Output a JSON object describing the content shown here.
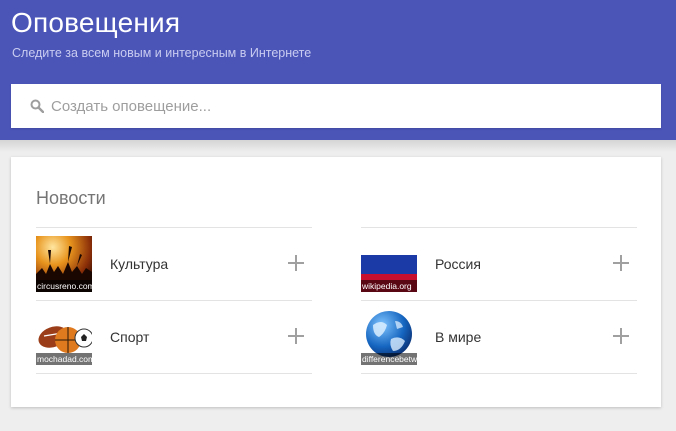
{
  "header": {
    "title": "Оповещения",
    "subtitle": "Следите за всем новым и интересным в Интернете",
    "color": "#4b55b8"
  },
  "search": {
    "placeholder": "Создать оповещение...",
    "icon": "search-icon"
  },
  "news": {
    "title": "Новости",
    "topics": [
      {
        "label": "Культура",
        "source": "circusreno.com",
        "icon": "plus-icon"
      },
      {
        "label": "Россия",
        "source": "wikipedia.org",
        "icon": "plus-icon"
      },
      {
        "label": "Спорт",
        "source": "mochadad.com",
        "icon": "plus-icon"
      },
      {
        "label": "В мире",
        "source": "differencebetween",
        "icon": "plus-icon"
      }
    ]
  }
}
